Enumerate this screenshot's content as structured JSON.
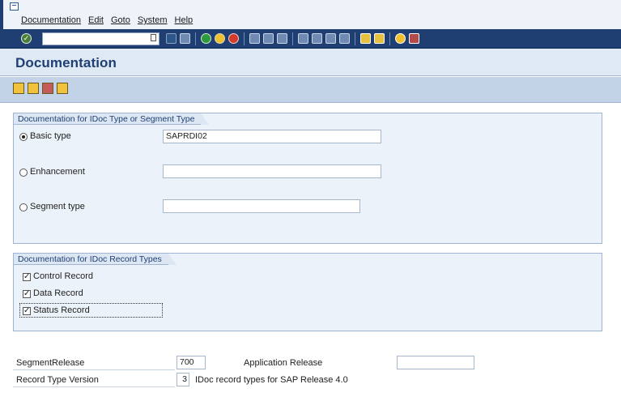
{
  "menubar": {
    "items": [
      "Documentation",
      "Edit",
      "Goto",
      "System",
      "Help"
    ]
  },
  "toolbar": {
    "command_field_value": "",
    "icons": [
      "enter-icon",
      "back-icon",
      "exit-icon",
      "cancel-icon",
      "print-icon",
      "find-icon",
      "find-next-icon",
      "first-page-icon",
      "previous-page-icon",
      "next-page-icon",
      "last-page-icon",
      "create-session-icon",
      "shortcut-icon",
      "help-icon",
      "customize-layout-icon"
    ]
  },
  "page": {
    "title": "Documentation"
  },
  "app_toolbar": {
    "icons": [
      "display-icon",
      "html-icon",
      "print-doc-icon",
      "parser-icon"
    ]
  },
  "group_idoc_type": {
    "title": "Documentation for IDoc Type or Segment Type",
    "options": [
      {
        "label": "Basic type",
        "selected": true,
        "value": "SAPRDI02"
      },
      {
        "label": "Enhancement",
        "selected": false,
        "value": ""
      },
      {
        "label": "Segment type",
        "selected": false,
        "value": ""
      }
    ]
  },
  "group_record_types": {
    "title": "Documentation for IDoc Record Types",
    "checkboxes": [
      {
        "label": "Control Record",
        "checked": true
      },
      {
        "label": "Data Record",
        "checked": true
      },
      {
        "label": "Status Record",
        "checked": true
      }
    ]
  },
  "bottom": {
    "segment_release_label": "SegmentRelease",
    "segment_release_value": "700",
    "application_release_label": "Application Release",
    "application_release_value": "",
    "record_type_version_label": "Record Type Version",
    "record_type_version_value": "3",
    "record_type_version_desc": "IDoc record types for SAP Release 4.0"
  },
  "colors": {
    "header_blue": "#1f3f73",
    "panel_bg": "#ecf2f9",
    "toolbar_bg": "#c2d3e8"
  }
}
